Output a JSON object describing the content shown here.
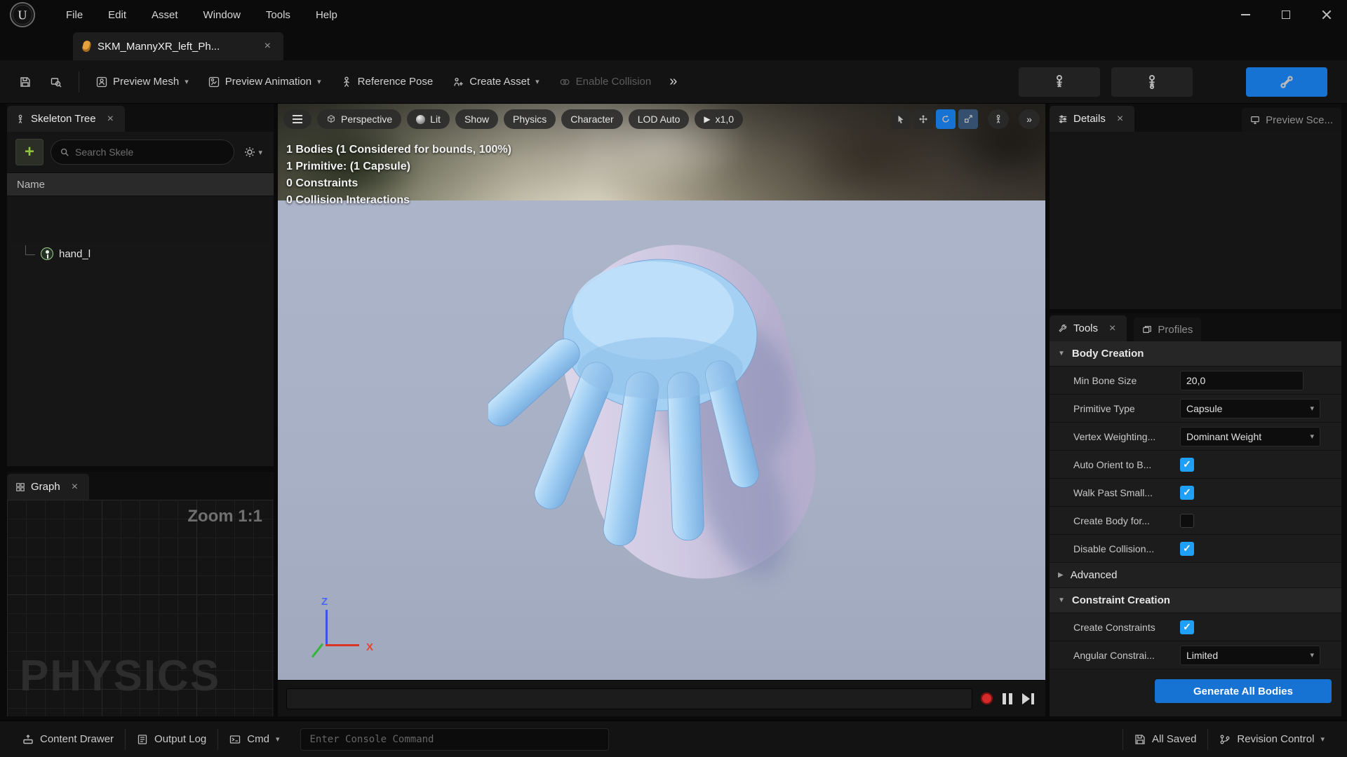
{
  "colors": {
    "accent": "#1673d3",
    "checkbox": "#1f9ff5",
    "record_red": "#d62b2b",
    "viewport_bg": "#a8b0c6",
    "capsule": "#cfc8e2",
    "hand_blue": "#9dcdf4"
  },
  "glyphs": {
    "close": "×",
    "chevron_down": "▾",
    "section_open": "▼",
    "section_closed": "▶",
    "play": "▶",
    "double_chevron": "»",
    "plus": "+"
  },
  "titlebar": {
    "menu": [
      "File",
      "Edit",
      "Asset",
      "Window",
      "Tools",
      "Help"
    ]
  },
  "asset_tab": {
    "label": "SKM_MannyXR_left_Ph..."
  },
  "toolbar": {
    "preview_mesh": "Preview Mesh",
    "preview_animation": "Preview Animation",
    "reference_pose": "Reference Pose",
    "create_asset": "Create Asset",
    "enable_collision": "Enable Collision"
  },
  "skeleton_panel": {
    "tab": "Skeleton Tree",
    "search_placeholder": "Search Skele",
    "name_header": "Name",
    "bone": "hand_l"
  },
  "graph_panel": {
    "tab": "Graph",
    "zoom": "Zoom 1:1",
    "watermark": "PHYSICS"
  },
  "viewport": {
    "perspective": "Perspective",
    "lit": "Lit",
    "show": "Show",
    "physics": "Physics",
    "character": "Character",
    "lod": "LOD Auto",
    "speed": "x1,0",
    "stats": [
      "1 Bodies (1 Considered for bounds, 100%)",
      "1 Primitive: (1 Capsule)",
      "0 Constraints",
      "0 Collision Interactions"
    ],
    "axis": {
      "x": "X",
      "z": "Z"
    }
  },
  "details_panel": {
    "tab": "Details",
    "preview_scene_tab": "Preview Sce..."
  },
  "tools_panel": {
    "tab": "Tools",
    "profiles_tab": "Profiles",
    "sections": {
      "body_creation": "Body Creation",
      "advanced": "Advanced",
      "constraint_creation": "Constraint Creation"
    },
    "rows": {
      "min_bone_size": {
        "label": "Min Bone Size",
        "value": "20,0"
      },
      "primitive_type": {
        "label": "Primitive Type",
        "value": "Capsule"
      },
      "vertex_weighting": {
        "label": "Vertex Weighting...",
        "value": "Dominant Weight"
      },
      "auto_orient": {
        "label": "Auto Orient to B...",
        "checked": true
      },
      "walk_past": {
        "label": "Walk Past Small...",
        "checked": true
      },
      "create_body": {
        "label": "Create Body for...",
        "checked": false
      },
      "disable_collision": {
        "label": "Disable Collision...",
        "checked": true
      },
      "create_constraints": {
        "label": "Create Constraints",
        "checked": true
      },
      "angular_constraint": {
        "label": "Angular Constrai...",
        "value": "Limited"
      }
    },
    "generate_button": "Generate All Bodies"
  },
  "statusbar": {
    "content_drawer": "Content Drawer",
    "output_log": "Output Log",
    "cmd": "Cmd",
    "console_placeholder": "Enter Console Command",
    "all_saved": "All Saved",
    "revision_control": "Revision Control"
  }
}
